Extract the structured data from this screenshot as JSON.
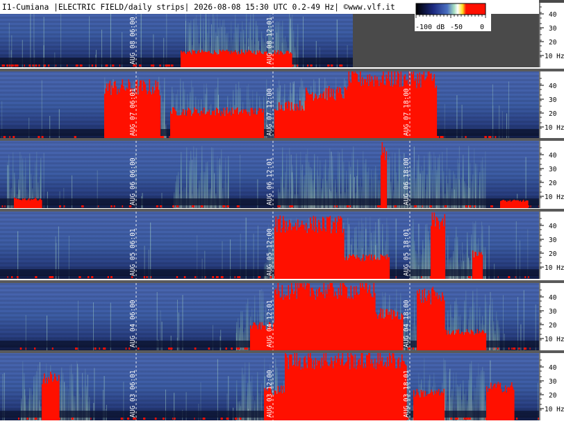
{
  "header": {
    "title": "I1-Cumiana |ELECTRIC FIELD/daily strips| 2026-08-08 15:30 UTC 0.2-49 Hz| ©www.vlf.it"
  },
  "colorbar": {
    "labels": [
      "-100 dB",
      "-50",
      "0"
    ],
    "colors": [
      "#000000",
      "#1c2a80",
      "#4a6fc0",
      "#a8e0c0",
      "#ffffff",
      "#ffe020",
      "#ff1000"
    ]
  },
  "axis": {
    "ticks": [
      "40",
      "30",
      "20",
      "10 Hz"
    ]
  },
  "palette": {
    "background": "#3a5a9a",
    "dark_band": "#0c1430",
    "green": "#9ad8b4",
    "red": "#ff1000",
    "separator": "#5a5a5a",
    "empty_area": "#4a4a4a"
  },
  "strips": [
    {
      "id": "aug-08",
      "time_labels": [
        {
          "label": "AUG 08  06:00"
        },
        {
          "label": "AUG 08  12:01"
        }
      ]
    },
    {
      "id": "aug-07",
      "time_labels": [
        {
          "label": "AUG 07  06:01"
        },
        {
          "label": "AUG 07  12:00"
        },
        {
          "label": "AUG 07  18:00"
        }
      ]
    },
    {
      "id": "aug-06",
      "time_labels": [
        {
          "label": "AUG 06  06:00"
        },
        {
          "label": "AUG 06  12:01"
        },
        {
          "label": "AUG 06  18:00"
        }
      ]
    },
    {
      "id": "aug-05",
      "time_labels": [
        {
          "label": "AUG 05  06:01"
        },
        {
          "label": "AUG 05  12:00"
        },
        {
          "label": "AUG 05  18:01"
        }
      ]
    },
    {
      "id": "aug-04",
      "time_labels": [
        {
          "label": "AUG 04  06:00"
        },
        {
          "label": "AUG 04  12:01"
        },
        {
          "label": "AUG 04  18:00"
        }
      ]
    },
    {
      "id": "aug-03",
      "time_labels": [
        {
          "label": "AUG 03  06:01"
        },
        {
          "label": "AUG 03  12:00"
        },
        {
          "label": "AUG 03  18:01"
        }
      ]
    }
  ]
}
